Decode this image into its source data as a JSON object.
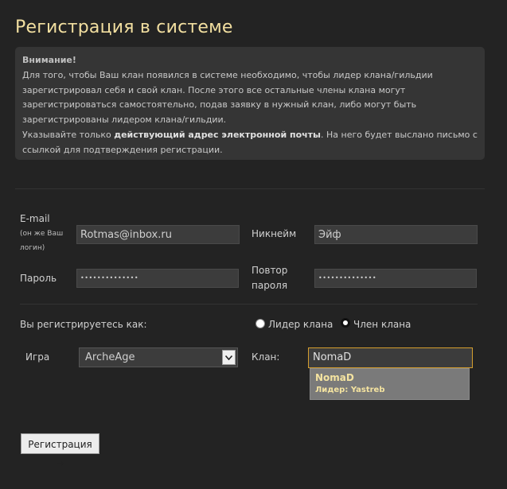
{
  "page": {
    "title": "Регистрация в системе"
  },
  "notice": {
    "heading": "Внимание!",
    "p1": "Для того, чтобы Ваш клан появился в системе необходимо, чтобы лидер клана/гильдии зарегистрировал себя и свой клан. После этого все остальные члены клана могут зарегистрироваться самостоятельно, подав заявку в нужный клан, либо могут быть зарегистрированы лидером клана/гильдии.",
    "p2_before": "Указывайте только ",
    "p2_bold": "действующий адрес электронной почты",
    "p2_after": ". На него будет выслано письмо с ссылкой для подтверждения регистрации."
  },
  "form": {
    "email_label": "E-mail",
    "email_sub1": "(он же Ваш",
    "email_sub2": "логин)",
    "email_value": "Rotmas@inbox.ru",
    "nick_label": "Никнейм",
    "nick_value": "Эйф",
    "password_label": "Пароль",
    "password_value": "••••••••••••••",
    "repeat_label1": "Повтор",
    "repeat_label2": "пароля",
    "repeat_value": "••••••••••••••",
    "register_as_label": "Вы регистрируетесь как:",
    "role_leader": "Лидер клана",
    "role_member": "Член клана",
    "role_selected": "member",
    "game_label": "Игра",
    "game_value": "ArcheAge",
    "clan_label": "Клан:",
    "clan_value": "NomaD",
    "suggestion_name": "NomaD",
    "suggestion_leader_prefix": "Лидер: ",
    "suggestion_leader_name": "Yastreb",
    "submit_label": "Регистрация →"
  },
  "colors": {
    "accent": "#f2dfa0",
    "focus_border": "#d49e2e",
    "background": "#232323"
  },
  "icons": {
    "select_arrow": "chevron-down-icon"
  }
}
